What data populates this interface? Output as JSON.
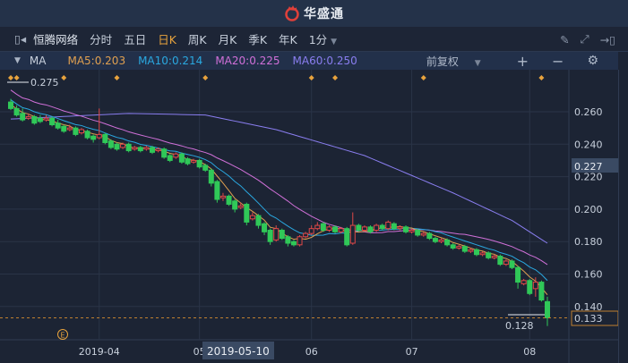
{
  "app": {
    "brand": "华盛通"
  },
  "toolbar": {
    "stock_name": "恒腾网络",
    "periods": [
      "分时",
      "五日",
      "日K",
      "周K",
      "月K",
      "季K",
      "年K"
    ],
    "active_period": "日K",
    "minute_select": "1分"
  },
  "ma_row": {
    "indicator": "MA",
    "ma5": "MA5:0.203",
    "ma10": "MA10:0.214",
    "ma20": "MA20:0.225",
    "ma60": "MA60:0.250",
    "adjust": "前复权"
  },
  "colors": {
    "ma5": "#e0a050",
    "ma10": "#2aa8e0",
    "ma20": "#d070d8",
    "ma60": "#8a7ef0",
    "up": "#e04848",
    "down": "#30c858",
    "marker": "#e8a33d"
  },
  "chart_data": {
    "type": "candlestick",
    "y_ticks": [
      "0.260",
      "0.240",
      "0.220",
      "0.200",
      "0.180",
      "0.160",
      "0.140"
    ],
    "ylim": [
      0.128,
      0.275
    ],
    "x_labels": [
      "2019-04",
      "05",
      "06",
      "07",
      "08"
    ],
    "x_label_index": [
      15,
      32,
      51,
      68,
      88
    ],
    "ohlc": [
      [
        0.266,
        0.268,
        0.261,
        0.262
      ],
      [
        0.262,
        0.264,
        0.257,
        0.258
      ],
      [
        0.259,
        0.262,
        0.254,
        0.255
      ],
      [
        0.256,
        0.259,
        0.255,
        0.257
      ],
      [
        0.257,
        0.258,
        0.252,
        0.253
      ],
      [
        0.256,
        0.258,
        0.253,
        0.254
      ],
      [
        0.255,
        0.258,
        0.254,
        0.256
      ],
      [
        0.256,
        0.257,
        0.251,
        0.252
      ],
      [
        0.253,
        0.255,
        0.249,
        0.25
      ],
      [
        0.251,
        0.252,
        0.247,
        0.248
      ],
      [
        0.249,
        0.252,
        0.248,
        0.25
      ],
      [
        0.25,
        0.251,
        0.245,
        0.246
      ],
      [
        0.247,
        0.25,
        0.246,
        0.249
      ],
      [
        0.248,
        0.249,
        0.243,
        0.244
      ],
      [
        0.245,
        0.246,
        0.241,
        0.243
      ],
      [
        0.244,
        0.262,
        0.243,
        0.246
      ],
      [
        0.246,
        0.247,
        0.24,
        0.241
      ],
      [
        0.242,
        0.243,
        0.237,
        0.238
      ],
      [
        0.24,
        0.241,
        0.236,
        0.237
      ],
      [
        0.238,
        0.241,
        0.237,
        0.24
      ],
      [
        0.24,
        0.241,
        0.235,
        0.236
      ],
      [
        0.237,
        0.239,
        0.236,
        0.238
      ],
      [
        0.238,
        0.239,
        0.235,
        0.236
      ],
      [
        0.237,
        0.239,
        0.236,
        0.238
      ],
      [
        0.238,
        0.239,
        0.234,
        0.235
      ],
      [
        0.236,
        0.238,
        0.235,
        0.237
      ],
      [
        0.237,
        0.238,
        0.231,
        0.232
      ],
      [
        0.233,
        0.234,
        0.229,
        0.23
      ],
      [
        0.232,
        0.235,
        0.231,
        0.234
      ],
      [
        0.234,
        0.235,
        0.228,
        0.229
      ],
      [
        0.231,
        0.232,
        0.227,
        0.228
      ],
      [
        0.229,
        0.231,
        0.228,
        0.23
      ],
      [
        0.23,
        0.231,
        0.225,
        0.226
      ],
      [
        0.227,
        0.228,
        0.223,
        0.224
      ],
      [
        0.224,
        0.225,
        0.214,
        0.216
      ],
      [
        0.217,
        0.218,
        0.204,
        0.206
      ],
      [
        0.207,
        0.21,
        0.205,
        0.208
      ],
      [
        0.208,
        0.209,
        0.202,
        0.203
      ],
      [
        0.205,
        0.206,
        0.198,
        0.2
      ],
      [
        0.201,
        0.204,
        0.2,
        0.202
      ],
      [
        0.203,
        0.204,
        0.19,
        0.192
      ],
      [
        0.194,
        0.198,
        0.193,
        0.196
      ],
      [
        0.196,
        0.197,
        0.188,
        0.19
      ],
      [
        0.191,
        0.192,
        0.184,
        0.186
      ],
      [
        0.187,
        0.188,
        0.178,
        0.18
      ],
      [
        0.181,
        0.19,
        0.18,
        0.188
      ],
      [
        0.187,
        0.188,
        0.181,
        0.182
      ],
      [
        0.183,
        0.184,
        0.177,
        0.179
      ],
      [
        0.18,
        0.181,
        0.177,
        0.178
      ],
      [
        0.178,
        0.184,
        0.177,
        0.183
      ],
      [
        0.183,
        0.186,
        0.182,
        0.185
      ],
      [
        0.185,
        0.19,
        0.184,
        0.188
      ],
      [
        0.188,
        0.192,
        0.187,
        0.19
      ],
      [
        0.191,
        0.192,
        0.186,
        0.187
      ],
      [
        0.187,
        0.19,
        0.186,
        0.189
      ],
      [
        0.189,
        0.19,
        0.185,
        0.186
      ],
      [
        0.186,
        0.189,
        0.185,
        0.188
      ],
      [
        0.188,
        0.189,
        0.177,
        0.178
      ],
      [
        0.179,
        0.198,
        0.178,
        0.19
      ],
      [
        0.19,
        0.191,
        0.186,
        0.187
      ],
      [
        0.187,
        0.19,
        0.186,
        0.189
      ],
      [
        0.189,
        0.19,
        0.185,
        0.186
      ],
      [
        0.187,
        0.191,
        0.186,
        0.19
      ],
      [
        0.19,
        0.191,
        0.187,
        0.188
      ],
      [
        0.188,
        0.193,
        0.187,
        0.192
      ],
      [
        0.191,
        0.192,
        0.187,
        0.188
      ],
      [
        0.188,
        0.19,
        0.187,
        0.189
      ],
      [
        0.189,
        0.19,
        0.185,
        0.186
      ],
      [
        0.186,
        0.188,
        0.185,
        0.187
      ],
      [
        0.187,
        0.188,
        0.183,
        0.184
      ],
      [
        0.184,
        0.186,
        0.183,
        0.185
      ],
      [
        0.185,
        0.186,
        0.181,
        0.182
      ],
      [
        0.182,
        0.183,
        0.179,
        0.18
      ],
      [
        0.18,
        0.182,
        0.179,
        0.181
      ],
      [
        0.181,
        0.182,
        0.177,
        0.178
      ],
      [
        0.178,
        0.179,
        0.175,
        0.176
      ],
      [
        0.176,
        0.178,
        0.175,
        0.177
      ],
      [
        0.177,
        0.178,
        0.173,
        0.174
      ],
      [
        0.174,
        0.176,
        0.173,
        0.175
      ],
      [
        0.175,
        0.176,
        0.171,
        0.172
      ],
      [
        0.172,
        0.174,
        0.171,
        0.173
      ],
      [
        0.173,
        0.174,
        0.169,
        0.17
      ],
      [
        0.17,
        0.172,
        0.169,
        0.171
      ],
      [
        0.171,
        0.172,
        0.165,
        0.166
      ],
      [
        0.166,
        0.169,
        0.165,
        0.168
      ],
      [
        0.168,
        0.169,
        0.163,
        0.164
      ],
      [
        0.164,
        0.165,
        0.151,
        0.155
      ],
      [
        0.154,
        0.157,
        0.153,
        0.156
      ],
      [
        0.156,
        0.157,
        0.147,
        0.148
      ],
      [
        0.151,
        0.158,
        0.146,
        0.155
      ],
      [
        0.155,
        0.156,
        0.143,
        0.144
      ],
      [
        0.143,
        0.146,
        0.128,
        0.133
      ]
    ],
    "ma60": [
      [
        0,
        0.2555
      ],
      [
        20,
        0.259
      ],
      [
        33,
        0.258
      ],
      [
        45,
        0.249
      ],
      [
        60,
        0.233
      ],
      [
        75,
        0.21
      ],
      [
        85,
        0.193
      ],
      [
        91,
        0.179
      ]
    ],
    "event_marker_index": [
      0,
      1,
      9,
      18,
      33,
      51,
      55,
      70,
      90
    ],
    "high_label": "0.275",
    "low_label": "0.128",
    "last_price": "0.133",
    "cursor_price": "0.227",
    "cursor_date": "2019-05-10",
    "earnings_marker": "E"
  }
}
